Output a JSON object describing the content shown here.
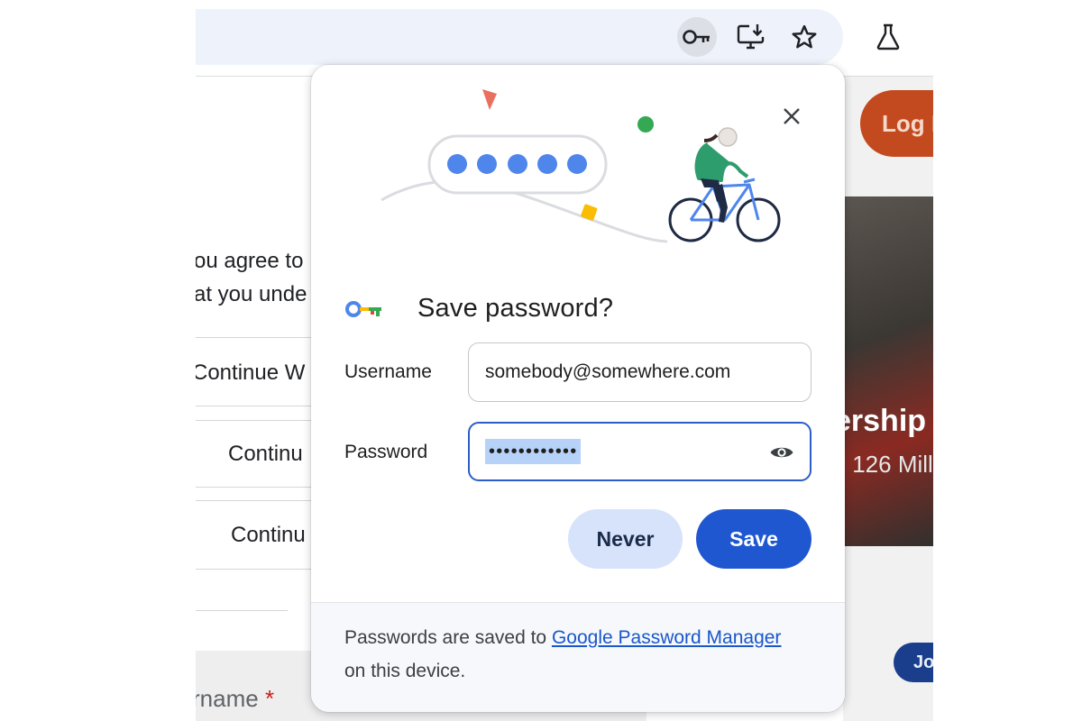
{
  "toolbar": {
    "icons": [
      "key-icon",
      "install-icon",
      "star-icon",
      "labs-flask-icon"
    ]
  },
  "background_page": {
    "line1": "ou agree to",
    "line2": "at you unde",
    "continue_1": "Continue W",
    "continue_2": "Continu",
    "continue_3": "Continu",
    "username_label": "rname",
    "required_mark": "*",
    "login_button": "Log I",
    "hero_title": "ership",
    "hero_subtitle": "s 126 Mill",
    "join_button": "Jo"
  },
  "dialog": {
    "title": "Save password?",
    "close_icon": "close-icon",
    "username_label": "Username",
    "username_value": "somebody@somewhere.com",
    "password_label": "Password",
    "password_value": "••••••••••••",
    "never_label": "Never",
    "save_label": "Save",
    "footer_text_before": "Passwords are saved to ",
    "footer_link": "Google Password Manager",
    "footer_text_after": " on this device.",
    "colors": {
      "save_button": "#1f57d1",
      "never_button": "#d6e3fb",
      "focus_border": "#2b5ec9",
      "link": "#1a57c9"
    }
  }
}
